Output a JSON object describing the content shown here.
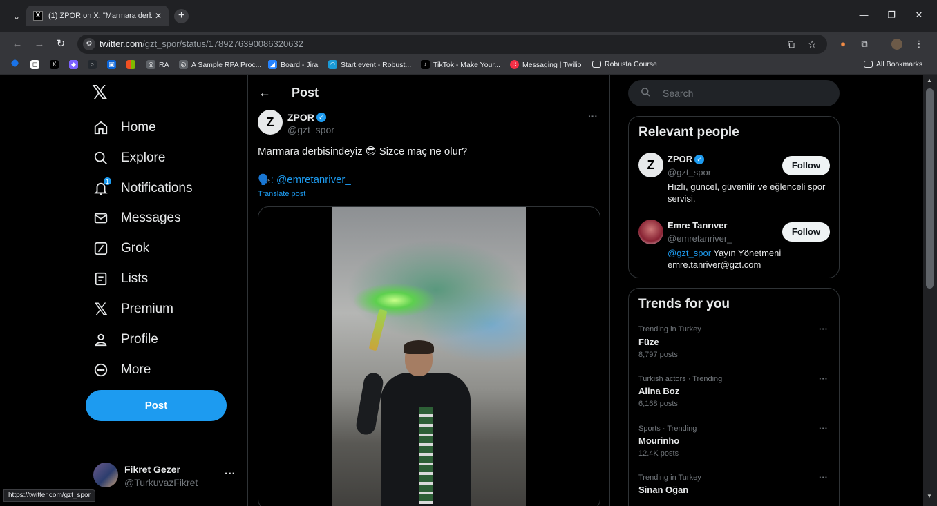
{
  "browser": {
    "tab_title": "(1) ZPOR on X: \"Marmara derbis",
    "url_domain": "twitter.com",
    "url_path": "/gzt_spor/status/1789276390086320632",
    "bookmarks": [
      "RA",
      "A Sample RPA Proc...",
      "Board - Jira",
      "Start event - Robust...",
      "TikTok - Make Your...",
      "Messaging | Twilio",
      "Robusta Course"
    ],
    "all_bookmarks": "All Bookmarks",
    "status_url": "https://twitter.com/gzt_spor"
  },
  "nav": {
    "items": [
      {
        "label": "Home",
        "icon": "home-icon"
      },
      {
        "label": "Explore",
        "icon": "search-icon"
      },
      {
        "label": "Notifications",
        "icon": "bell-icon",
        "badge": "1"
      },
      {
        "label": "Messages",
        "icon": "envelope-icon"
      },
      {
        "label": "Grok",
        "icon": "grok-icon"
      },
      {
        "label": "Lists",
        "icon": "list-icon"
      },
      {
        "label": "Premium",
        "icon": "x-icon"
      },
      {
        "label": "Profile",
        "icon": "person-icon"
      },
      {
        "label": "More",
        "icon": "more-circle-icon"
      }
    ],
    "post_button": "Post",
    "account": {
      "name": "Fikret Gezer",
      "handle": "@TurkuvazFikret"
    }
  },
  "post": {
    "header": "Post",
    "author_name": "ZPOR",
    "author_handle": "@gzt_spor",
    "avatar_letter": "Z",
    "text": "Marmara derbisindeyiz 😎 Sizce maç ne olur?",
    "mention": "🗣️: @emretanriver_",
    "translate": "Translate post"
  },
  "sidebar": {
    "search_placeholder": "Search",
    "relevant_title": "Relevant people",
    "people": [
      {
        "name": "ZPOR",
        "handle": "@gzt_spor",
        "bio": "Hızlı, güncel, güvenilir ve eğlenceli spor servisi.",
        "follow": "Follow"
      },
      {
        "name": "Emre Tanrıver",
        "handle": "@emretanriver_",
        "bio_link": "@gzt_spor",
        "bio": " Yayın Yönetmeni emre.tanriver@gzt.com",
        "follow": "Follow"
      }
    ],
    "trends_title": "Trends for you",
    "trends": [
      {
        "context": "Trending in Turkey",
        "name": "Füze",
        "count": "8,797 posts"
      },
      {
        "context": "Turkish actors · Trending",
        "name": "Alina Boz",
        "count": "6,168 posts"
      },
      {
        "context": "Sports · Trending",
        "name": "Mourinho",
        "count": "12.4K posts"
      },
      {
        "context": "Trending in Turkey",
        "name": "Sinan Oğan",
        "count": ""
      }
    ]
  },
  "colors": {
    "accent": "#1d9bf0",
    "background": "#000000",
    "border": "#2f3336",
    "secondary_text": "#71767b"
  }
}
